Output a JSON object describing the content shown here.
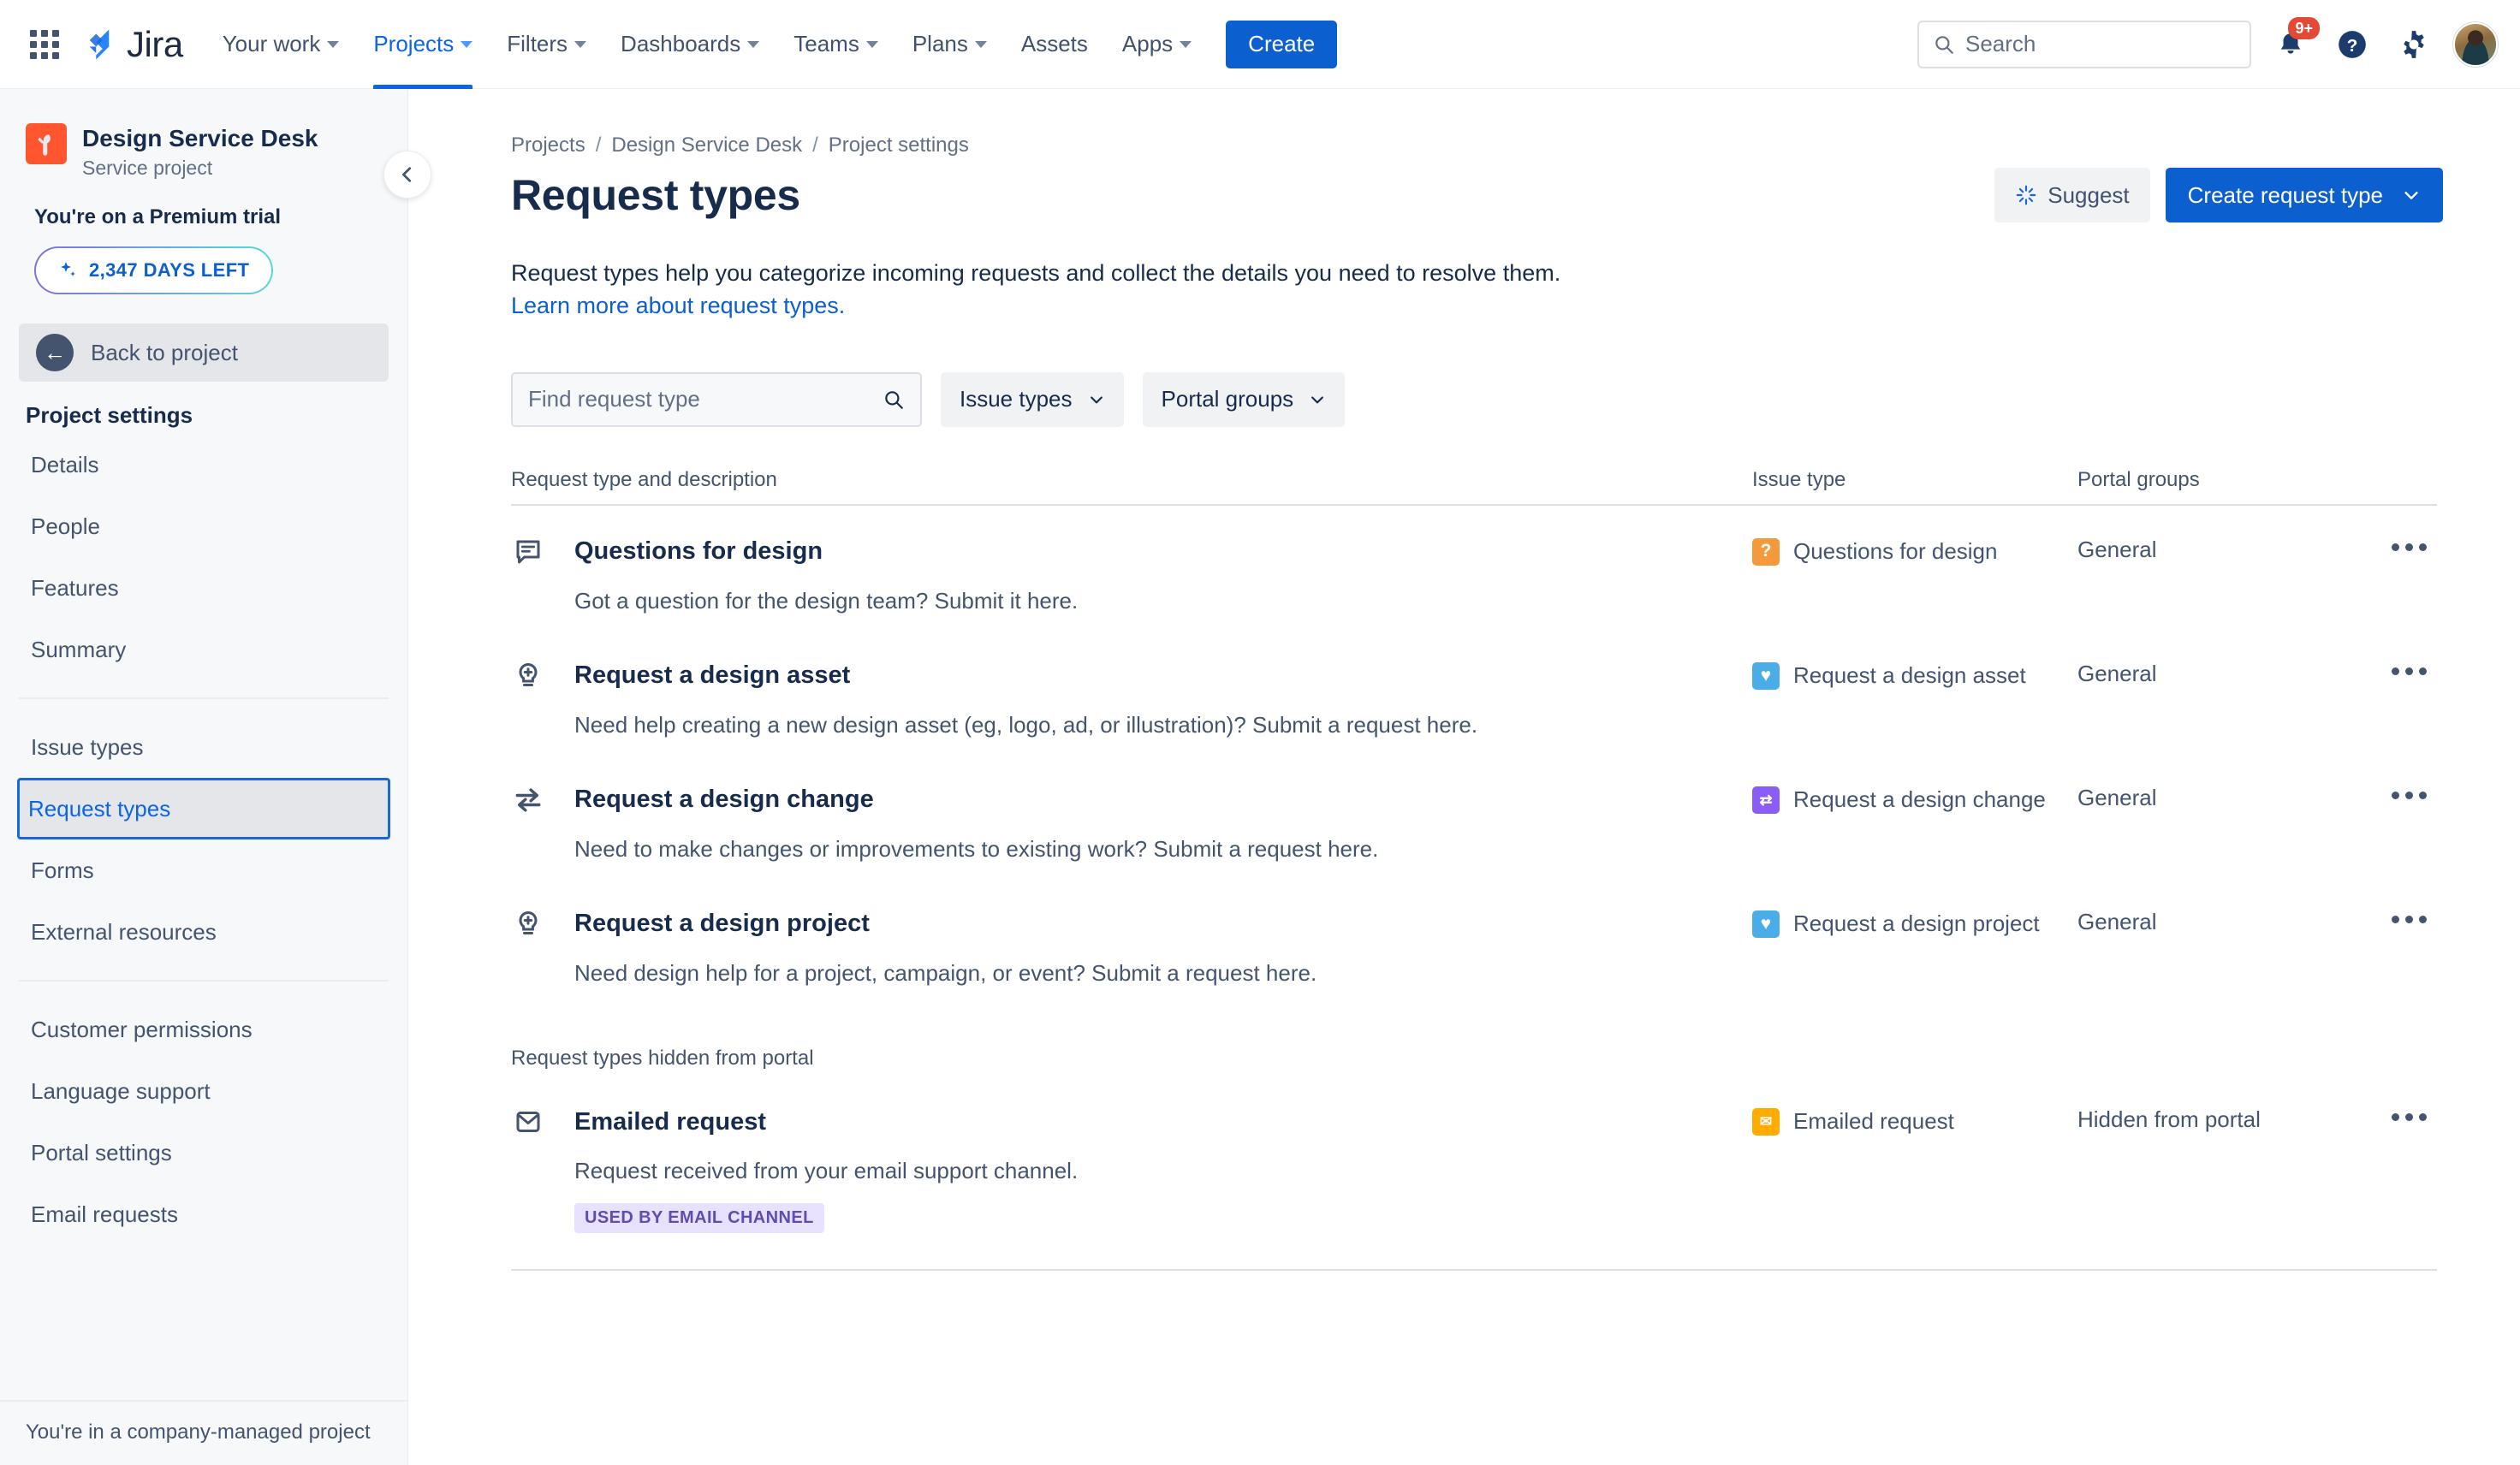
{
  "topnav": {
    "app_switcher_icon": "grid-icon",
    "brand": "Jira",
    "items": [
      {
        "label": "Your work",
        "has_caret": true,
        "active": false
      },
      {
        "label": "Projects",
        "has_caret": true,
        "active": true
      },
      {
        "label": "Filters",
        "has_caret": true,
        "active": false
      },
      {
        "label": "Dashboards",
        "has_caret": true,
        "active": false
      },
      {
        "label": "Teams",
        "has_caret": true,
        "active": false
      },
      {
        "label": "Plans",
        "has_caret": true,
        "active": false
      },
      {
        "label": "Assets",
        "has_caret": false,
        "active": false
      },
      {
        "label": "Apps",
        "has_caret": true,
        "active": false
      }
    ],
    "create_label": "Create",
    "search_placeholder": "Search",
    "notification_badge": "9+",
    "icons": [
      "notification-bell-icon",
      "help-icon",
      "settings-gear-icon",
      "user-avatar"
    ]
  },
  "sidebar": {
    "project_name": "Design Service Desk",
    "project_type": "Service project",
    "trial_title": "You're on a Premium trial",
    "trial_days": "2,347 DAYS LEFT",
    "back_label": "Back to project",
    "section_title": "Project settings",
    "group1": [
      "Details",
      "People",
      "Features",
      "Summary"
    ],
    "group2": [
      "Issue types",
      "Request types",
      "Forms",
      "External resources"
    ],
    "group3": [
      "Customer permissions",
      "Language support",
      "Portal settings",
      "Email requests"
    ],
    "selected_item": "Request types",
    "footer": "You're in a company-managed project",
    "collapse_icon": "chevron-left-icon"
  },
  "main": {
    "breadcrumb": [
      "Projects",
      "Design Service Desk",
      "Project settings"
    ],
    "breadcrumb_separator": "/",
    "page_title": "Request types",
    "suggest_label": "Suggest",
    "create_request_type_label": "Create request type",
    "intro_text": "Request types help you categorize incoming requests and collect the details you need to resolve them.",
    "intro_link": "Learn more about request types.",
    "find_placeholder": "Find request type",
    "filter_issue_types": "Issue types",
    "filter_portal_groups": "Portal groups",
    "columns": {
      "name": "Request type and description",
      "issue_type": "Issue type",
      "portal_groups": "Portal groups"
    },
    "hidden_section_label": "Request types hidden from portal",
    "rows": [
      {
        "icon": "comment-lines-icon",
        "title": "Questions for design",
        "description": "Got a question for the design team? Submit it here.",
        "issue_type": "Questions for design",
        "issue_icon": "question-mark-icon",
        "issue_color": "#F5993D",
        "issue_glyph": "?",
        "portal_group": "General",
        "tag": ""
      },
      {
        "icon": "lightbulb-plus-icon",
        "title": "Request a design asset",
        "description": "Need help creating a new design asset (eg, logo, ad, or illustration)? Submit a request here.",
        "issue_type": "Request a design asset",
        "issue_icon": "heart-icon",
        "issue_color": "#4BADE8",
        "issue_glyph": "♥",
        "portal_group": "General",
        "tag": ""
      },
      {
        "icon": "swap-arrows-icon",
        "title": "Request a design change",
        "description": "Need to make changes or improvements to existing work? Submit a request here.",
        "issue_type": "Request a design change",
        "issue_icon": "transfer-arrows-icon",
        "issue_color": "#8B5CF6",
        "issue_glyph": "⇄",
        "portal_group": "General",
        "tag": ""
      },
      {
        "icon": "lightbulb-plus-icon",
        "title": "Request a design project",
        "description": "Need design help for a project, campaign, or event? Submit a request here.",
        "issue_type": "Request a design project",
        "issue_icon": "heart-icon",
        "issue_color": "#4BADE8",
        "issue_glyph": "♥",
        "portal_group": "General",
        "tag": ""
      }
    ],
    "hidden_rows": [
      {
        "icon": "envelope-icon",
        "title": "Emailed request",
        "description": "Request received from your email support channel.",
        "issue_type": "Emailed request",
        "issue_icon": "envelope-icon",
        "issue_color": "#FFAB00",
        "issue_glyph": "✉",
        "portal_group": "Hidden from portal",
        "tag": "USED BY EMAIL CHANNEL"
      }
    ]
  },
  "colors": {
    "brand_blue": "#0C5FCE",
    "link_blue": "#0C66E4",
    "text": "#172B4D",
    "subtle_text": "#44546F",
    "sidebar_bg": "#F7F8F9",
    "badge_red": "#E34935",
    "tag_bg": "#E9E2FE",
    "tag_text": "#5E4DB2"
  }
}
